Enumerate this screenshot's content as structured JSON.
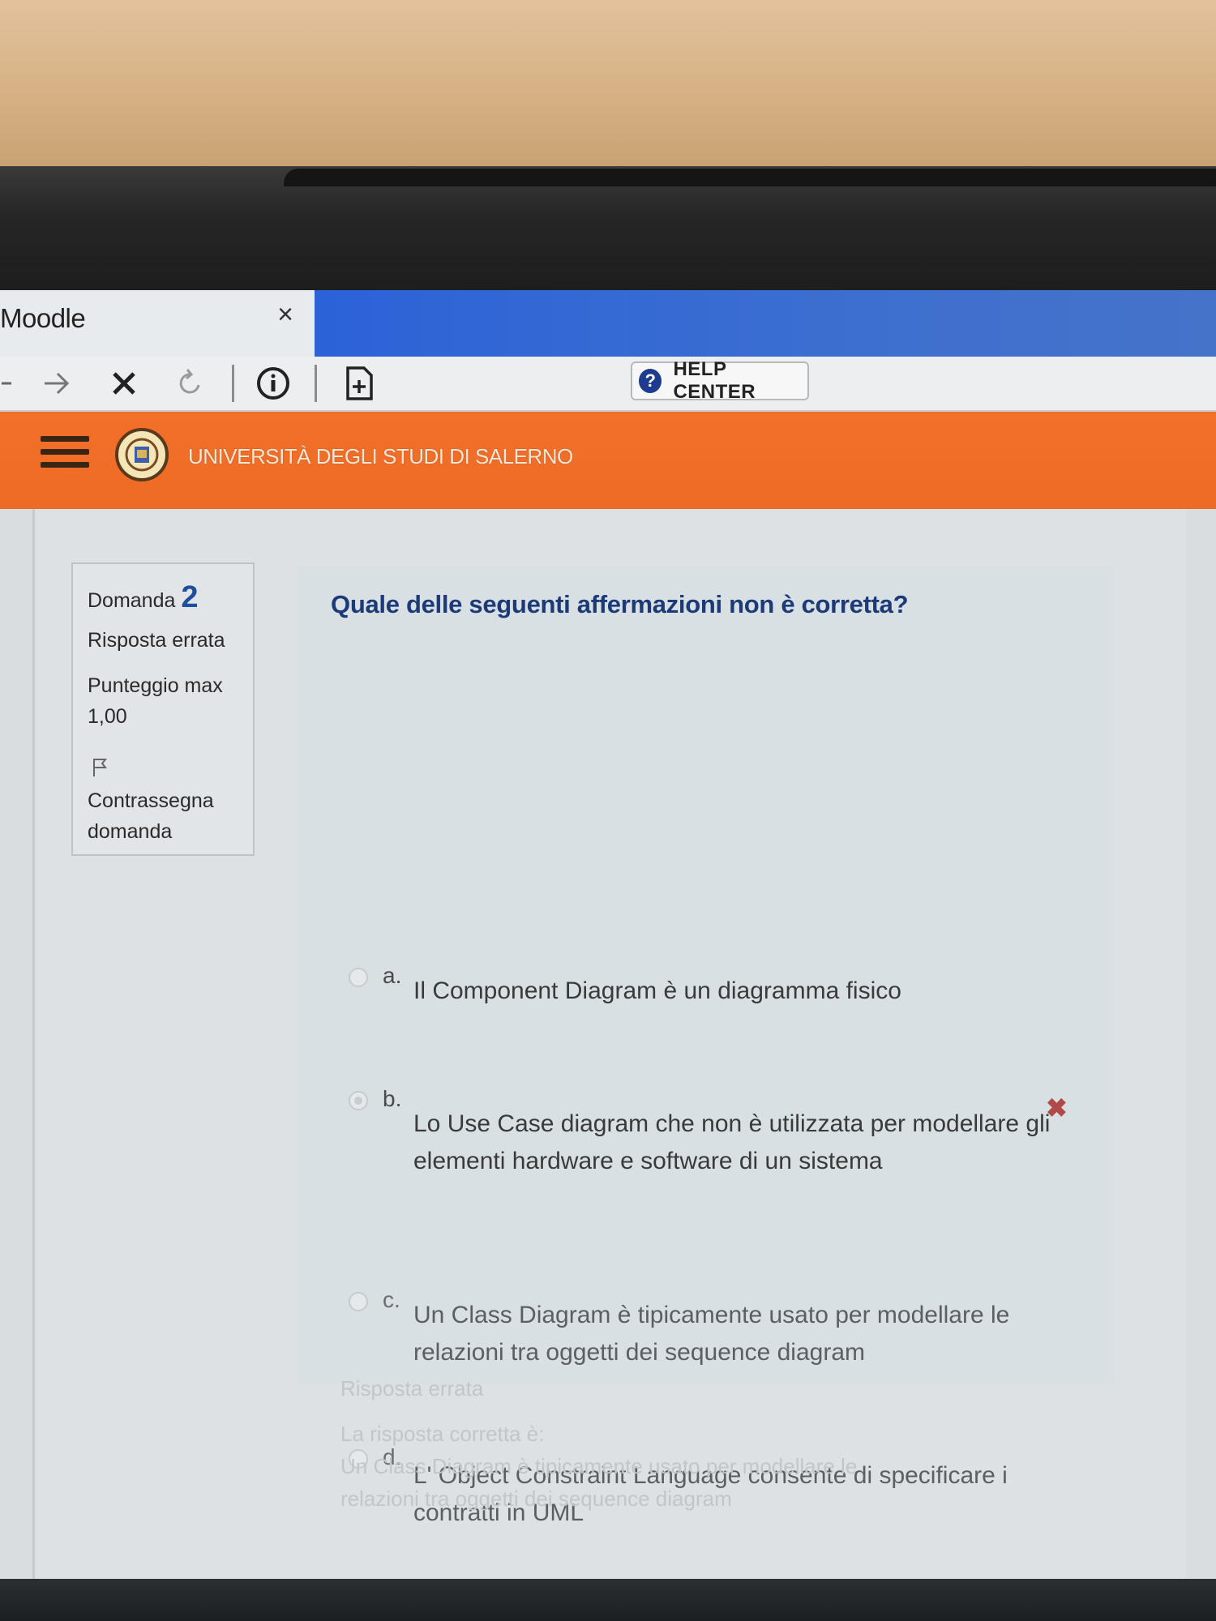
{
  "browser": {
    "tab_title": "Moodle",
    "tab_close": "×",
    "help_label": "HELP CENTER",
    "icons": [
      "back-icon",
      "forward-icon",
      "stop-icon",
      "reload-icon",
      "info-icon",
      "new-page-icon",
      "help-icon"
    ]
  },
  "header": {
    "university_name": "UNIVERSITÀ DEGLI STUDI DI SALERNO",
    "accent": "#ee6b25"
  },
  "question_info": {
    "label": "Domanda",
    "number": "2",
    "status": "Risposta errata",
    "score_label": "Punteggio max",
    "score_value": "1,00",
    "flag_line1": "Contrassegna",
    "flag_line2": "domanda"
  },
  "question": {
    "text": "Quale delle seguenti affermazioni non è corretta?",
    "options": [
      {
        "letter": "a.",
        "text": "Il Component Diagram è un diagramma fisico",
        "selected": false
      },
      {
        "letter": "b.",
        "text": "Lo Use Case diagram che non è utilizzata per modellare gli elementi hardware e software di un sistema",
        "selected": true,
        "result": "wrong"
      },
      {
        "letter": "c.",
        "text": "Un Class Diagram è tipicamente usato per modellare le relazioni tra oggetti dei sequence diagram",
        "selected": false
      },
      {
        "letter": "d.",
        "text": "L' Object Constraint Language consente di specificare i contratti in UML",
        "selected": false
      }
    ],
    "wrong_mark": "✖"
  },
  "feedback": {
    "status": "Risposta errata",
    "correct_intro": "La risposta corretta è:",
    "correct_line1": "Un Class Diagram è tipicamente usato per modellare le",
    "correct_line2": "relazioni tra oggetti dei sequence diagram"
  }
}
